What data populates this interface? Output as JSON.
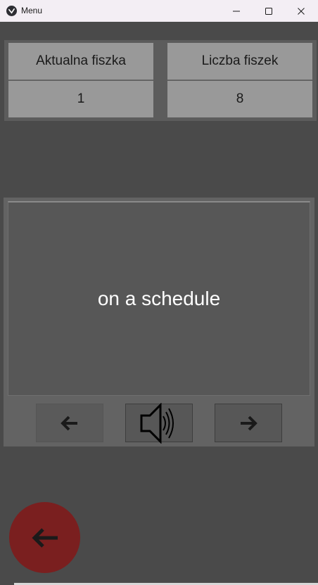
{
  "window": {
    "title": "Menu"
  },
  "stats": {
    "current_label": "Aktualna fiszka",
    "current_value": "1",
    "count_label": "Liczba fiszek",
    "count_value": "8"
  },
  "card": {
    "text": "on a schedule"
  },
  "controls": {
    "prev_icon": "arrow-left-icon",
    "sound_icon": "speaker-icon",
    "next_icon": "arrow-right-icon",
    "back_icon": "arrow-left-icon"
  },
  "colors": {
    "background": "#4a4a4a",
    "back_button": "#7a1f1f",
    "stat_cell": "#999999",
    "card_text": "#ffffff"
  }
}
